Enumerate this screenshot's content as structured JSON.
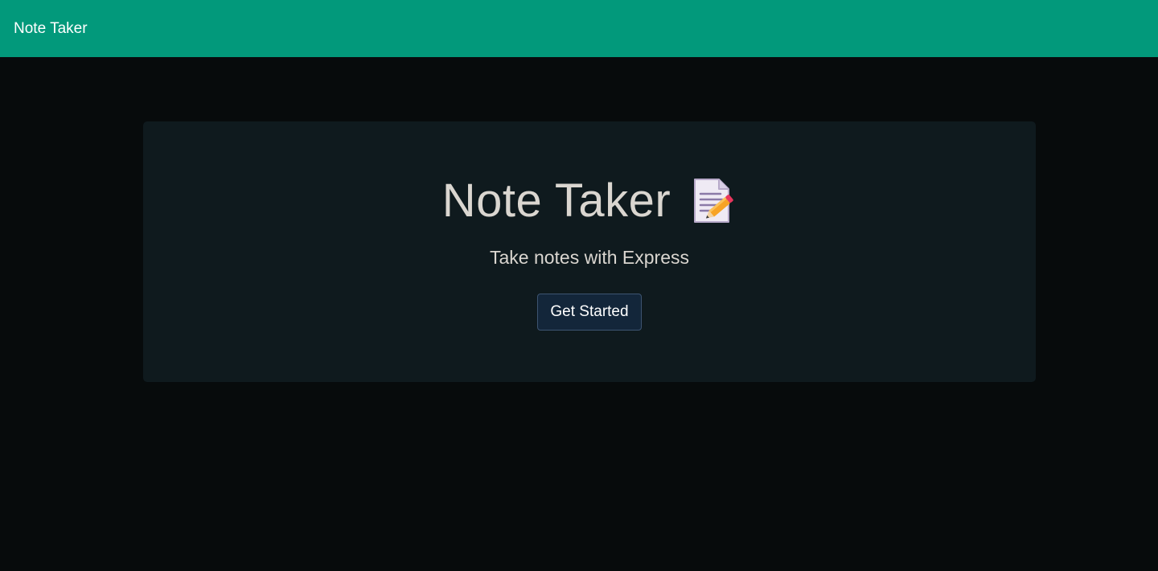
{
  "navbar": {
    "brand": "Note Taker",
    "bg_color": "#02997b"
  },
  "hero": {
    "title": "Note Taker",
    "title_icon": "memo-icon",
    "subtitle": "Take notes with Express",
    "cta_label": "Get Started"
  },
  "colors": {
    "page_bg": "#070b0c",
    "card_bg": "#0f1a1e",
    "text": "#dad6d0",
    "button_bg": "#13263a",
    "button_border": "#3d5471"
  }
}
